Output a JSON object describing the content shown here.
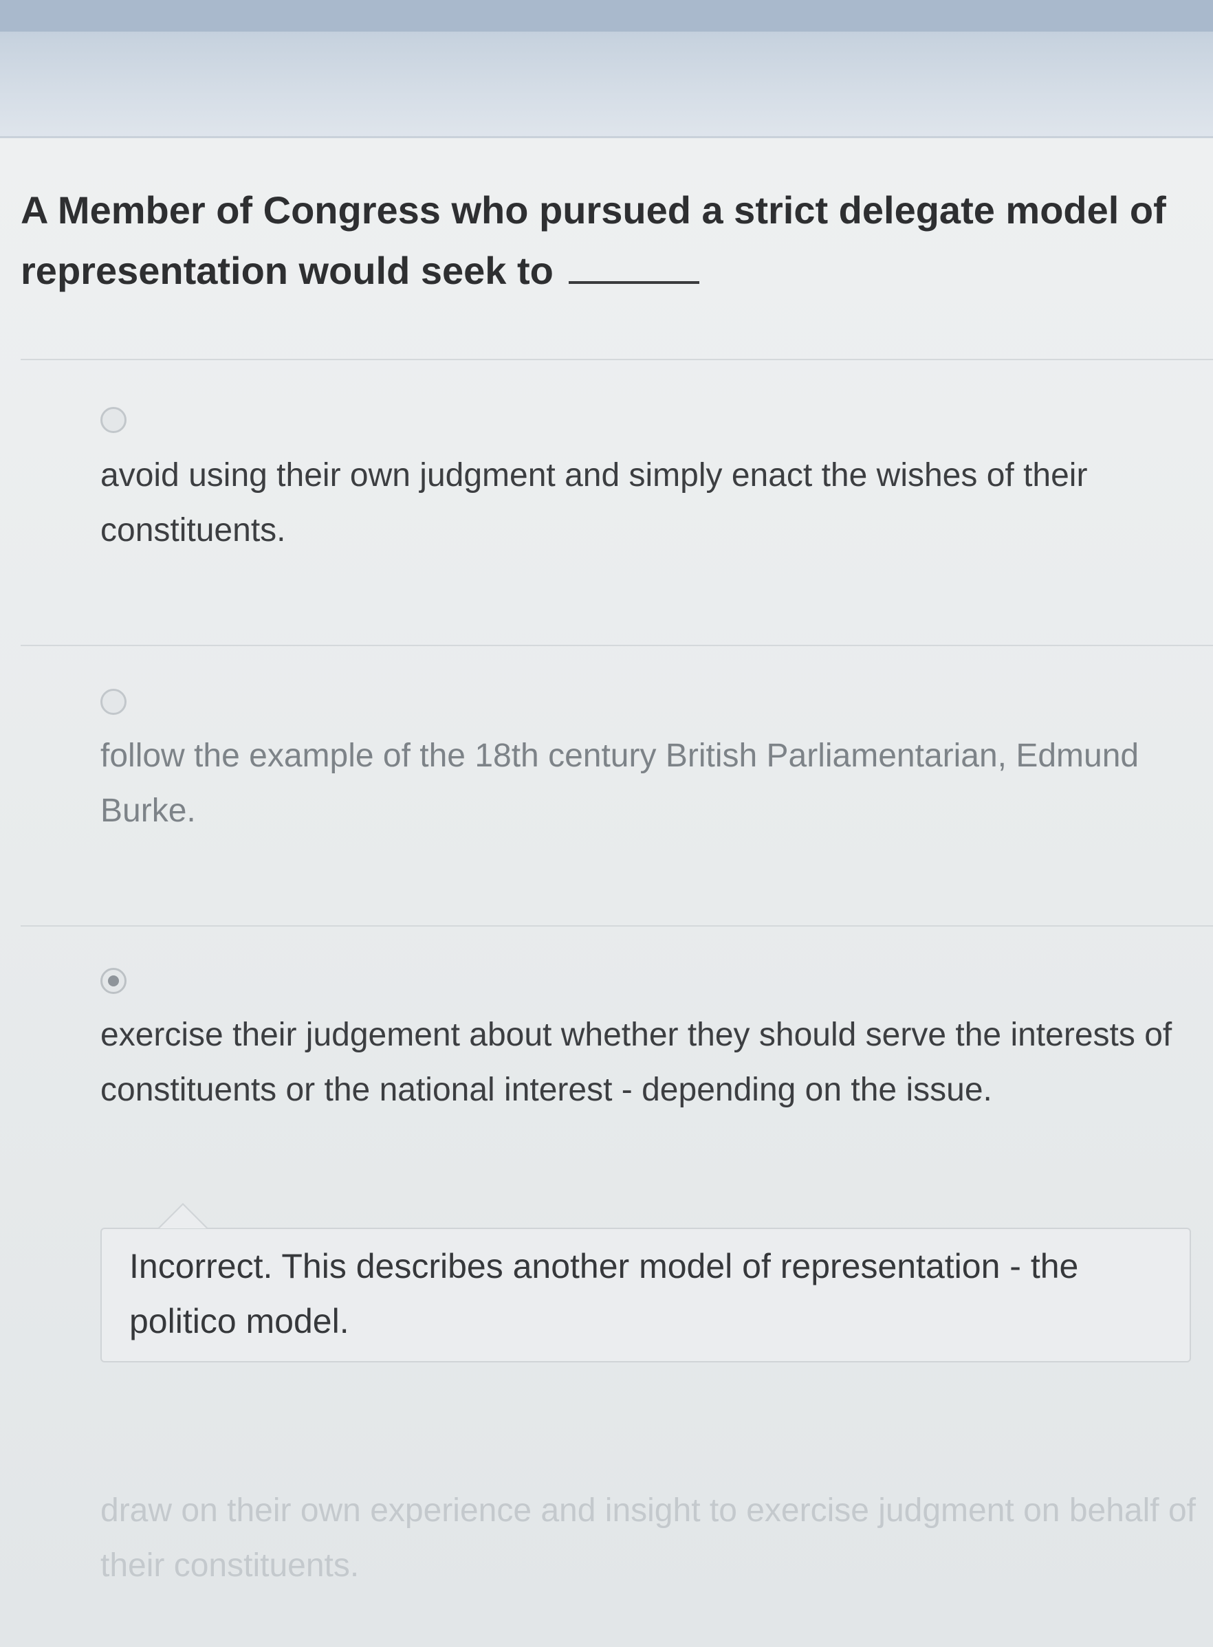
{
  "question": {
    "text": "A Member of Congress who pursued a strict delegate model of representation would seek to"
  },
  "options": [
    {
      "text": "avoid using their own judgment and simply enact the wishes of their constituents.",
      "selected": false
    },
    {
      "text": "follow the example of the 18th century British Parliamentarian, Edmund Burke.",
      "selected": false
    },
    {
      "text": "exercise their judgement about whether they should serve the interests of constituents or the national interest - depending on the issue.",
      "selected": true
    },
    {
      "text": "draw on their own experience and insight to exercise judgment on behalf of their constituents.",
      "selected": false
    }
  ],
  "feedback": {
    "text": "Incorrect. This describes another model of representation - the politico model."
  }
}
